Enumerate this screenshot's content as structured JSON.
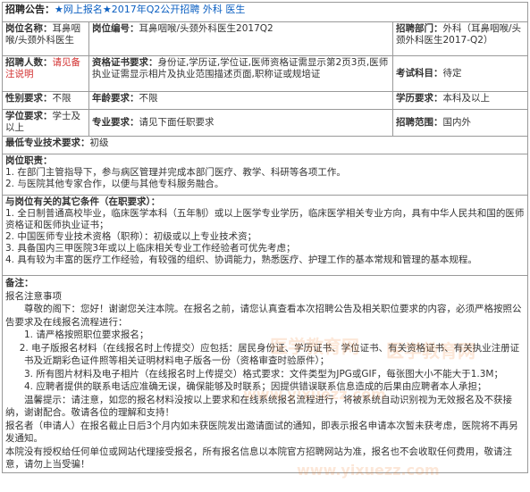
{
  "header": {
    "label": "招聘公告：",
    "title": "★网上报名★2017年Q2公开招聘 外科 医生"
  },
  "row1": {
    "position_label": "岗位名称：",
    "position_value": "耳鼻咽喉/头颈外科医生",
    "code_label": "岗位编号：",
    "code_value": "耳鼻咽喉/头颈外科医生2017Q2",
    "dept_label": "招聘部门：",
    "dept_value": "外科（耳鼻咽喉/头颈外科医生2017-Q2）"
  },
  "row2": {
    "count_label": "招聘人数：",
    "count_value": "请见备注说明",
    "cert_label": "资格证书要求：",
    "cert_value": "身份证,学历证,学位证,医师资格证需显示第2页3页,医师执业证需显示相片及执业范围描述页面,职称证或规培证",
    "exam_label": "考试科目：",
    "exam_value": "待定"
  },
  "row3": {
    "gender_label": "性别要求：",
    "gender_value": "不限",
    "age_label": "年龄要求：",
    "age_value": "不限",
    "edu_label": "学历要求：",
    "edu_value": "本科及以上"
  },
  "row4": {
    "degree_label": "学位要求：",
    "degree_value": "学士及以上",
    "major_label": "专业要求：",
    "major_value": "请见下面任职要求",
    "scope_label": "招聘范围：",
    "scope_value": "国内外"
  },
  "row5": {
    "tech_label": "最低专业技术要求：",
    "tech_value": "初级"
  },
  "duties": {
    "title": "岗位职责：",
    "items": [
      "1. 在部门主管指导下，参与病区管理并完成本部门医疗、教学、科研等各项工作。",
      "2. 与医院其他专家合作，以便与其他专科服务融合。"
    ]
  },
  "conditions": {
    "title": "与岗位有关的其它条件（在职要求）：",
    "items": [
      "1. 全日制普通高校毕业，临床医学本科（五年制）或以上医学专业学历，临床医学相关专业方向，具有中华人民共和国的医师资格证和医师执业证书；",
      "2. 中国医师专业技术资格（职称）：初级或以上专业技术资；",
      "3. 具备国内三甲医院3年或以上临床相关专业工作经验者可优先考虑；",
      "4. 具有较为丰富的医疗工作经验，有较强的组织、协调能力，熟悉医疗、护理工作的基本常规和管理的基本规程。"
    ]
  },
  "remarks": {
    "title": "备注：",
    "subtitle": "报名注意事项",
    "lines": [
      "尊敬的阁下：您好！谢谢您关注本院。在报名之前，请您认真查看本次招聘公告及相关职位要求的内容，必须严格按照公告要求及在线报名流程进行：",
      "1. 请严格按照职位要求报名；",
      "2. 电子版报名材料（在线报名时上传提交）应包括：居民身份证、学历证书、学位证书、有关资格证书、有关执业注册证书及近期彩色证件照等相关证明材料电子版各一份（资格审查时验原件）；",
      "3. 所有图片材料及电子相片（在线报名时上传提交）格式要求：文件类型为JPG或GIF，每张图大小不能大于1.3M；",
      "4. 应聘者提供的联系电话应准确无误，确保能够及时联系；因提供错误联系信息造成的后果由应聘者本人承担；",
      "温馨提示：请注意，如您的报名材料没按以上要求和在线系统报名流程进行，将被系统自动识别视为无效报名及不获接纳，谢谢配合。敬请各位的理解和支持！",
      "报名者（申请人）在报名截止日后3个月内如未获医院发出邀请面试的通知，即表示报名申请本次暂未获考虑，医院将不再另发通知。",
      "本院没有授权给任何单位或网站代理接受报名，所有报名信息以本院官方招聘网站为准，报名也不会收取任何费用，敬请注意，请勿上当受骗！"
    ]
  },
  "watermarks": [
    "医学教育网",
    "医学教育网",
    "www.yixuezz.com",
    "www.yixuezz.com"
  ],
  "colors": {
    "accent_blue": "#0b5fc1",
    "accent_red": "#d23030",
    "border": "#999999"
  }
}
